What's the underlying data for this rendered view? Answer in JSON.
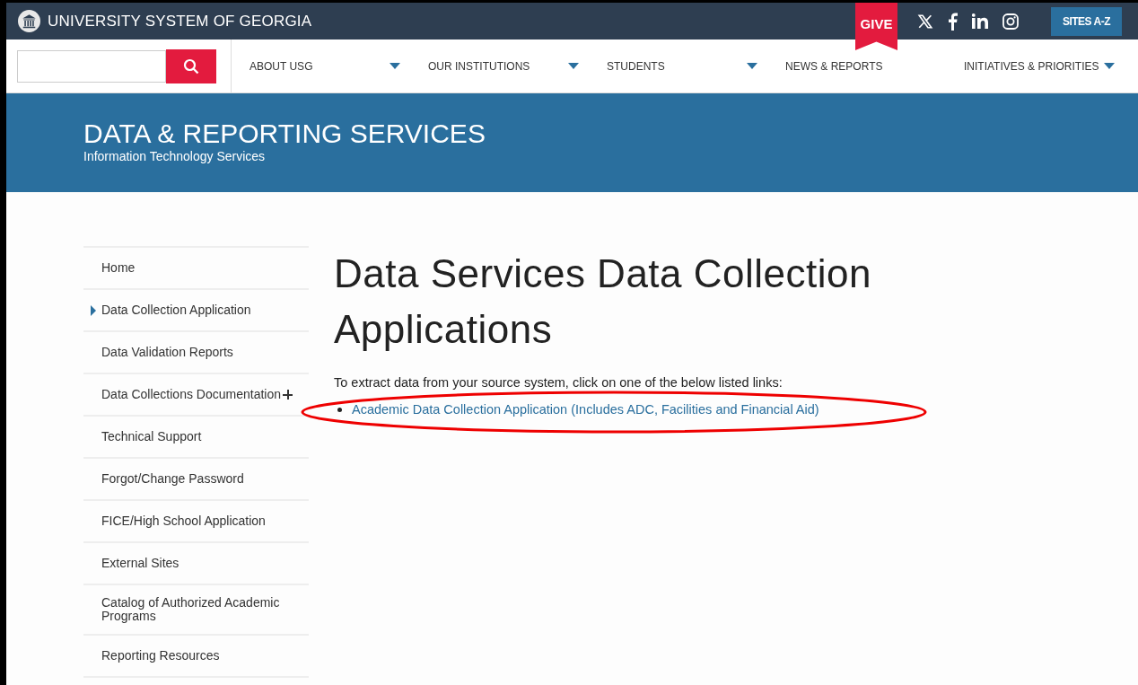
{
  "header": {
    "brand": "UNIVERSITY SYSTEM OF GEORGIA",
    "give": "GIVE",
    "sites_button": "SITES A-Z"
  },
  "nav": {
    "items": [
      {
        "label": "ABOUT USG",
        "dropdown": true
      },
      {
        "label": "OUR INSTITUTIONS",
        "dropdown": true
      },
      {
        "label": "STUDENTS",
        "dropdown": true
      },
      {
        "label": "NEWS & REPORTS",
        "dropdown": false
      },
      {
        "label": "INITIATIVES & PRIORITIES",
        "dropdown": true
      }
    ]
  },
  "banner": {
    "title": "DATA & REPORTING SERVICES",
    "subtitle": "Information Technology Services"
  },
  "sidebar": {
    "items": [
      {
        "label": "Home",
        "selected": false,
        "expandable": false
      },
      {
        "label": "Data Collection Application",
        "selected": true,
        "expandable": false
      },
      {
        "label": "Data Validation Reports",
        "selected": false,
        "expandable": false
      },
      {
        "label": "Data Collections Documentation",
        "selected": false,
        "expandable": true
      },
      {
        "label": "Technical Support",
        "selected": false,
        "expandable": false
      },
      {
        "label": "Forgot/Change Password",
        "selected": false,
        "expandable": false
      },
      {
        "label": "FICE/High School Application",
        "selected": false,
        "expandable": false
      },
      {
        "label": "External Sites",
        "selected": false,
        "expandable": false
      },
      {
        "label": "Catalog of Authorized Academic Programs",
        "selected": false,
        "expandable": false
      },
      {
        "label": "Reporting Resources",
        "selected": false,
        "expandable": false
      }
    ]
  },
  "main": {
    "title": "Data Services Data Collection Applications",
    "intro": "To extract data from your source system, click on one of the below listed links:",
    "links": [
      {
        "label": "Academic Data Collection Application (Includes ADC, Facilities and Financial Aid)",
        "highlighted": true
      }
    ]
  }
}
